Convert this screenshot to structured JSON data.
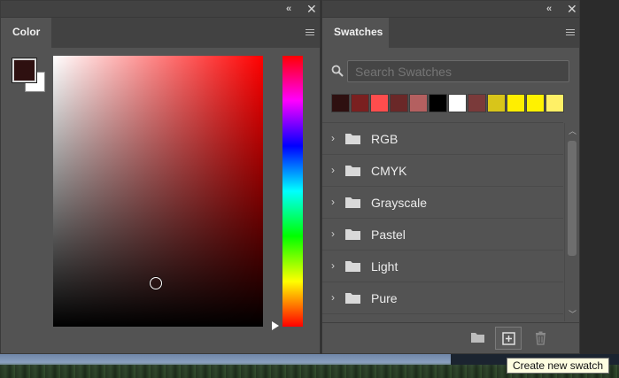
{
  "color_panel": {
    "tab_label": "Color",
    "collapse_glyph": "«",
    "close_glyph": "✕",
    "foreground_color": "#2e1010",
    "background_color": "#ffffff",
    "hue_color": "#ff0000"
  },
  "swatches_panel": {
    "tab_label": "Swatches",
    "collapse_glyph": "«",
    "close_glyph": "✕",
    "search": {
      "placeholder": "Search Swatches",
      "value": ""
    },
    "recent_swatches": [
      "#2e1010",
      "#7a2020",
      "#ff4d4d",
      "#6a2828",
      "#b46060",
      "#000000",
      "#ffffff",
      "#7a3a3a",
      "#d8c51a",
      "#ffee00",
      "#fff200",
      "#fff066"
    ],
    "groups": [
      {
        "name": "RGB"
      },
      {
        "name": "CMYK"
      },
      {
        "name": "Grayscale"
      },
      {
        "name": "Pastel"
      },
      {
        "name": "Light"
      },
      {
        "name": "Pure"
      }
    ],
    "footer_buttons": [
      {
        "name": "new-group-button",
        "icon": "folder-icon"
      },
      {
        "name": "create-new-swatch-button",
        "icon": "plus-square-icon"
      },
      {
        "name": "delete-swatch-button",
        "icon": "trash-icon"
      }
    ]
  },
  "tooltip": {
    "text": "Create new swatch"
  }
}
